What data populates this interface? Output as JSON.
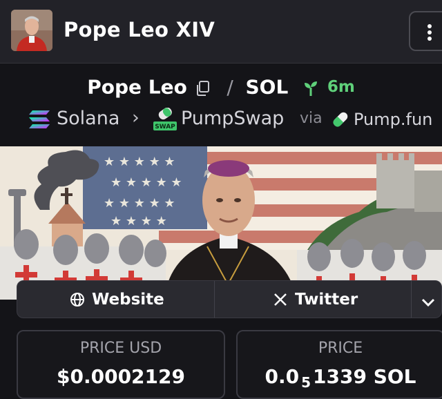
{
  "header": {
    "token_name": "Pope Leo XIV",
    "avatar_icon": "pope-portrait"
  },
  "pair": {
    "base": "Pope Leo",
    "separator": "/",
    "quote": "SOL",
    "age": "6m",
    "age_color": "#5fd07a"
  },
  "chain": {
    "network": "Solana",
    "dex": "PumpSwap",
    "dex_badge": "SWAP",
    "via_label": "via",
    "launchpad": "Pump.fun"
  },
  "links": {
    "website_label": "Website",
    "twitter_label": "Twitter"
  },
  "prices": {
    "usd_label": "PRICE USD",
    "usd_value": "$0.0002129",
    "native_label": "PRICE",
    "native_prefix": "0.0",
    "native_zero_count": "5",
    "native_digits": "1339",
    "native_unit": "SOL"
  },
  "colors": {
    "background": "#141418",
    "header_bg": "#222228",
    "accent_green": "#5fd07a"
  }
}
